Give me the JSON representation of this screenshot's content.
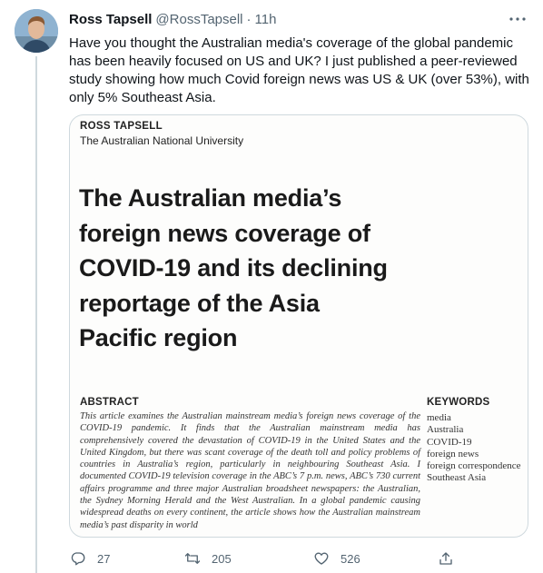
{
  "tweet": {
    "author_name": "Ross Tapsell",
    "author_handle": "@RossTapsell",
    "separator": "·",
    "timestamp": "11h",
    "text": "Have you thought the Australian media's coverage of the global pandemic has been heavily focused on US and UK? I just published a peer-reviewed study showing how much Covid foreign news was US & UK (over 53%), with only 5% Southeast Asia."
  },
  "paper": {
    "author": "ROSS TAPSELL",
    "affiliation": "The Australian National University",
    "title": "The Australian media’s\nforeign news coverage of\nCOVID-19 and its declining\nreportage of the Asia\nPacific region",
    "abstract_heading": "ABSTRACT",
    "abstract_text": "This article examines the Australian mainstream media’s foreign news coverage of the COVID-19 pandemic. It finds that the Australian mainstream media has comprehensively covered the devastation of COVID-19 in the United States and the United Kingdom, but there was scant coverage of the death toll and policy problems of countries in Australia’s region, particularly in neighbouring Southeast Asia. I documented COVID-19 television coverage in the ABC’s 7 p.m. news, ABC’s 730 current affairs programme and three major Australian broadsheet newspapers: the Australian, the Sydney Morning Herald and the West Australian. In a global pandemic causing widespread deaths on every continent, the article shows how the Australian mainstream media’s past disparity in world",
    "keywords_heading": "KEYWORDS",
    "keywords": [
      "media",
      "Australia",
      "COVID-19",
      "foreign news",
      "foreign correspondence",
      "Southeast Asia"
    ]
  },
  "actions": {
    "reply_count": "27",
    "retweet_count": "205",
    "like_count": "526"
  },
  "colors": {
    "text": "#0f1419",
    "secondary": "#536471",
    "border": "#cfd9de"
  },
  "icons": [
    "more-icon",
    "reply-icon",
    "retweet-icon",
    "like-icon",
    "share-icon"
  ]
}
